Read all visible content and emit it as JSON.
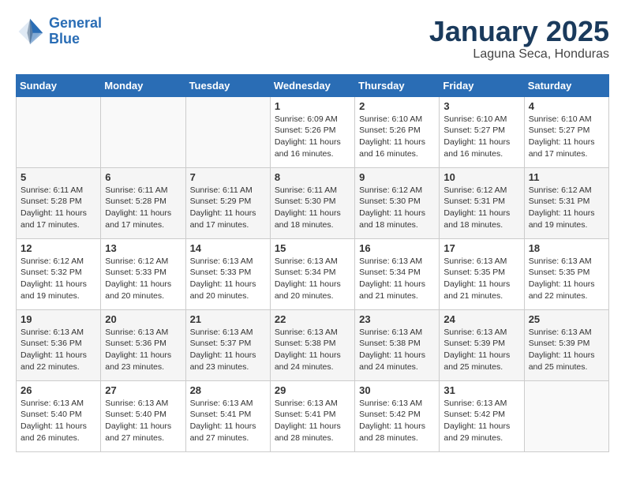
{
  "header": {
    "logo_line1": "General",
    "logo_line2": "Blue",
    "month": "January 2025",
    "location": "Laguna Seca, Honduras"
  },
  "weekdays": [
    "Sunday",
    "Monday",
    "Tuesday",
    "Wednesday",
    "Thursday",
    "Friday",
    "Saturday"
  ],
  "weeks": [
    [
      {
        "day": "",
        "content": ""
      },
      {
        "day": "",
        "content": ""
      },
      {
        "day": "",
        "content": ""
      },
      {
        "day": "1",
        "content": "Sunrise: 6:09 AM\nSunset: 5:26 PM\nDaylight: 11 hours and 16 minutes."
      },
      {
        "day": "2",
        "content": "Sunrise: 6:10 AM\nSunset: 5:26 PM\nDaylight: 11 hours and 16 minutes."
      },
      {
        "day": "3",
        "content": "Sunrise: 6:10 AM\nSunset: 5:27 PM\nDaylight: 11 hours and 16 minutes."
      },
      {
        "day": "4",
        "content": "Sunrise: 6:10 AM\nSunset: 5:27 PM\nDaylight: 11 hours and 17 minutes."
      }
    ],
    [
      {
        "day": "5",
        "content": "Sunrise: 6:11 AM\nSunset: 5:28 PM\nDaylight: 11 hours and 17 minutes."
      },
      {
        "day": "6",
        "content": "Sunrise: 6:11 AM\nSunset: 5:28 PM\nDaylight: 11 hours and 17 minutes."
      },
      {
        "day": "7",
        "content": "Sunrise: 6:11 AM\nSunset: 5:29 PM\nDaylight: 11 hours and 17 minutes."
      },
      {
        "day": "8",
        "content": "Sunrise: 6:11 AM\nSunset: 5:30 PM\nDaylight: 11 hours and 18 minutes."
      },
      {
        "day": "9",
        "content": "Sunrise: 6:12 AM\nSunset: 5:30 PM\nDaylight: 11 hours and 18 minutes."
      },
      {
        "day": "10",
        "content": "Sunrise: 6:12 AM\nSunset: 5:31 PM\nDaylight: 11 hours and 18 minutes."
      },
      {
        "day": "11",
        "content": "Sunrise: 6:12 AM\nSunset: 5:31 PM\nDaylight: 11 hours and 19 minutes."
      }
    ],
    [
      {
        "day": "12",
        "content": "Sunrise: 6:12 AM\nSunset: 5:32 PM\nDaylight: 11 hours and 19 minutes."
      },
      {
        "day": "13",
        "content": "Sunrise: 6:12 AM\nSunset: 5:33 PM\nDaylight: 11 hours and 20 minutes."
      },
      {
        "day": "14",
        "content": "Sunrise: 6:13 AM\nSunset: 5:33 PM\nDaylight: 11 hours and 20 minutes."
      },
      {
        "day": "15",
        "content": "Sunrise: 6:13 AM\nSunset: 5:34 PM\nDaylight: 11 hours and 20 minutes."
      },
      {
        "day": "16",
        "content": "Sunrise: 6:13 AM\nSunset: 5:34 PM\nDaylight: 11 hours and 21 minutes."
      },
      {
        "day": "17",
        "content": "Sunrise: 6:13 AM\nSunset: 5:35 PM\nDaylight: 11 hours and 21 minutes."
      },
      {
        "day": "18",
        "content": "Sunrise: 6:13 AM\nSunset: 5:35 PM\nDaylight: 11 hours and 22 minutes."
      }
    ],
    [
      {
        "day": "19",
        "content": "Sunrise: 6:13 AM\nSunset: 5:36 PM\nDaylight: 11 hours and 22 minutes."
      },
      {
        "day": "20",
        "content": "Sunrise: 6:13 AM\nSunset: 5:36 PM\nDaylight: 11 hours and 23 minutes."
      },
      {
        "day": "21",
        "content": "Sunrise: 6:13 AM\nSunset: 5:37 PM\nDaylight: 11 hours and 23 minutes."
      },
      {
        "day": "22",
        "content": "Sunrise: 6:13 AM\nSunset: 5:38 PM\nDaylight: 11 hours and 24 minutes."
      },
      {
        "day": "23",
        "content": "Sunrise: 6:13 AM\nSunset: 5:38 PM\nDaylight: 11 hours and 24 minutes."
      },
      {
        "day": "24",
        "content": "Sunrise: 6:13 AM\nSunset: 5:39 PM\nDaylight: 11 hours and 25 minutes."
      },
      {
        "day": "25",
        "content": "Sunrise: 6:13 AM\nSunset: 5:39 PM\nDaylight: 11 hours and 25 minutes."
      }
    ],
    [
      {
        "day": "26",
        "content": "Sunrise: 6:13 AM\nSunset: 5:40 PM\nDaylight: 11 hours and 26 minutes."
      },
      {
        "day": "27",
        "content": "Sunrise: 6:13 AM\nSunset: 5:40 PM\nDaylight: 11 hours and 27 minutes."
      },
      {
        "day": "28",
        "content": "Sunrise: 6:13 AM\nSunset: 5:41 PM\nDaylight: 11 hours and 27 minutes."
      },
      {
        "day": "29",
        "content": "Sunrise: 6:13 AM\nSunset: 5:41 PM\nDaylight: 11 hours and 28 minutes."
      },
      {
        "day": "30",
        "content": "Sunrise: 6:13 AM\nSunset: 5:42 PM\nDaylight: 11 hours and 28 minutes."
      },
      {
        "day": "31",
        "content": "Sunrise: 6:13 AM\nSunset: 5:42 PM\nDaylight: 11 hours and 29 minutes."
      },
      {
        "day": "",
        "content": ""
      }
    ]
  ]
}
